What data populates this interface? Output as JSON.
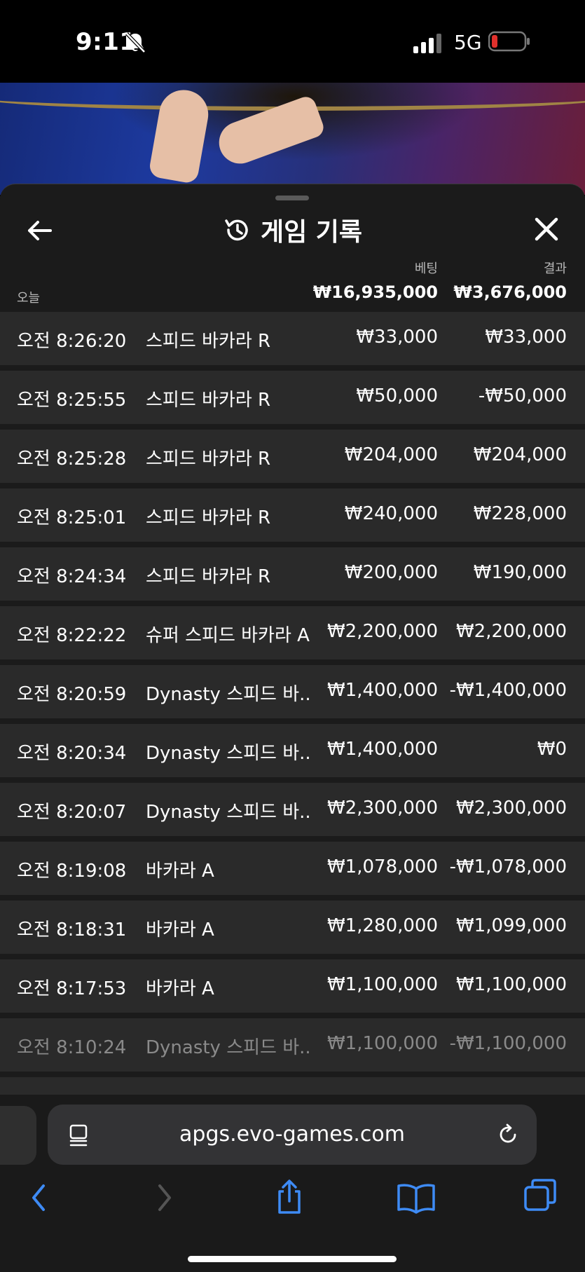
{
  "status_bar": {
    "time": "9:11",
    "network": "5G"
  },
  "sheet": {
    "title": "게임 기록",
    "bet_label": "베팅",
    "result_label": "결과",
    "today_label": "오늘",
    "bet_total": "₩16,935,000",
    "result_total": "₩3,676,000"
  },
  "rows": [
    {
      "time": "오전 8:26:20",
      "game": "스피드 바카라 R",
      "bet": "₩33,000",
      "result": "₩33,000"
    },
    {
      "time": "오전 8:25:55",
      "game": "스피드 바카라 R",
      "bet": "₩50,000",
      "result": "-₩50,000"
    },
    {
      "time": "오전 8:25:28",
      "game": "스피드 바카라 R",
      "bet": "₩204,000",
      "result": "₩204,000"
    },
    {
      "time": "오전 8:25:01",
      "game": "스피드 바카라 R",
      "bet": "₩240,000",
      "result": "₩228,000"
    },
    {
      "time": "오전 8:24:34",
      "game": "스피드 바카라 R",
      "bet": "₩200,000",
      "result": "₩190,000"
    },
    {
      "time": "오전 8:22:22",
      "game": "슈퍼 스피드 바카라 A",
      "bet": "₩2,200,000",
      "result": "₩2,200,000"
    },
    {
      "time": "오전 8:20:59",
      "game": "Dynasty 스피드 바...",
      "bet": "₩1,400,000",
      "result": "-₩1,400,000"
    },
    {
      "time": "오전 8:20:34",
      "game": "Dynasty 스피드 바...",
      "bet": "₩1,400,000",
      "result": "₩0"
    },
    {
      "time": "오전 8:20:07",
      "game": "Dynasty 스피드 바...",
      "bet": "₩2,300,000",
      "result": "₩2,300,000"
    },
    {
      "time": "오전 8:19:08",
      "game": "바카라 A",
      "bet": "₩1,078,000",
      "result": "-₩1,078,000"
    },
    {
      "time": "오전 8:18:31",
      "game": "바카라 A",
      "bet": "₩1,280,000",
      "result": "₩1,099,000"
    },
    {
      "time": "오전 8:17:53",
      "game": "바카라 A",
      "bet": "₩1,100,000",
      "result": "₩1,100,000"
    },
    {
      "time": "오전 8:10:24",
      "game": "Dynasty 스피드 바...",
      "bet": "₩1,100,000",
      "result": "-₩1,100,000"
    }
  ],
  "browser": {
    "url": "apgs.evo-games.com"
  },
  "icons": {
    "back": "arrow-left-icon",
    "history": "history-icon",
    "close": "close-icon",
    "bell": "bell-slash-icon",
    "reader": "page-menu-icon",
    "reload": "reload-icon",
    "nav_back": "chevron-left-icon",
    "nav_forward": "chevron-right-icon",
    "share": "share-icon",
    "bookmarks": "book-icon",
    "tabs": "tabs-icon"
  },
  "colors": {
    "accent_blue": "#3e8bf5",
    "sheet_bg": "#1b1b1b",
    "row_bg": "#2a2a2a",
    "battery_low": "#e0302c"
  }
}
